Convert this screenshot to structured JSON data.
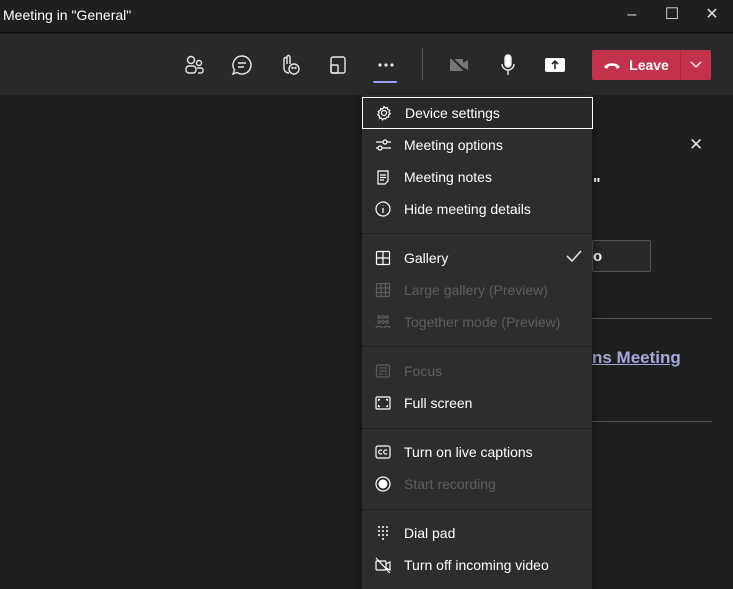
{
  "window": {
    "title": "Meeting in \"General\"",
    "minimize": "–",
    "maximize": "☐",
    "close": "✕"
  },
  "toolbar": {
    "leave_label": "Leave"
  },
  "menu": {
    "items": [
      {
        "label": "Device settings",
        "icon": "gear-icon",
        "disabled": false
      },
      {
        "label": "Meeting options",
        "icon": "sliders-icon",
        "disabled": false
      },
      {
        "label": "Meeting notes",
        "icon": "notes-icon",
        "disabled": false
      },
      {
        "label": "Hide meeting details",
        "icon": "info-icon",
        "disabled": false
      },
      {
        "label": "Gallery",
        "icon": "gallery-icon",
        "disabled": false,
        "checked": true
      },
      {
        "label": "Large gallery (Preview)",
        "icon": "large-gallery-icon",
        "disabled": true
      },
      {
        "label": "Together mode (Preview)",
        "icon": "together-mode-icon",
        "disabled": true
      },
      {
        "label": "Focus",
        "icon": "focus-icon",
        "disabled": true
      },
      {
        "label": "Full screen",
        "icon": "fullscreen-icon",
        "disabled": false
      },
      {
        "label": "Turn on live captions",
        "icon": "captions-icon",
        "disabled": false
      },
      {
        "label": "Start recording",
        "icon": "record-icon",
        "disabled": true
      },
      {
        "label": "Dial pad",
        "icon": "dialpad-icon",
        "disabled": false
      },
      {
        "label": "Turn off incoming video",
        "icon": "video-off-icon",
        "disabled": false
      }
    ]
  },
  "panel": {
    "close": "✕",
    "quote_fragment": "\"",
    "button_fragment": "o",
    "link_fragment": "ns Meeting"
  },
  "colors": {
    "accent": "#9ea2ff",
    "leave": "#c4314b",
    "link": "#a6a7dc"
  }
}
